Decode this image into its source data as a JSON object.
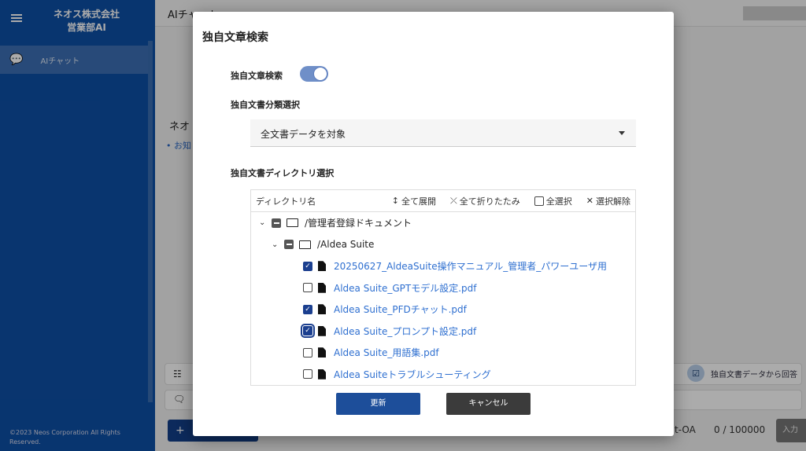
{
  "sidebar": {
    "brand_line1": "ネオス株式会社",
    "brand_line2": "営業部AI",
    "nav": [
      {
        "label": "AIチャット",
        "icon": "chat-bubbles-icon"
      }
    ],
    "copyright": "©2023 Neos Corporation All Rights Reserved."
  },
  "main": {
    "title": "AIチャット",
    "greeting": "ネオ",
    "notice_link": "お知",
    "indicator_label": "独自文書データから回答",
    "model": "t-OA",
    "char_count": "0 / 100000",
    "send_label": "入力",
    "new_label": "+"
  },
  "modal": {
    "title": "独自文章検索",
    "toggle_label": "独自文章検索",
    "toggle_on": true,
    "category_label": "独自文書分類選択",
    "category_value": "全文書データを対象",
    "dir_label": "独自文書ディレクトリ選択",
    "tree_header": {
      "name": "ディレクトリ名",
      "expand": "全て展開",
      "collapse": "全て折りたたみ",
      "select_all": "全選択",
      "deselect": "選択解除"
    },
    "folders": [
      {
        "name": "/管理者登録ドキュメント"
      },
      {
        "name": "/Aldea Suite"
      }
    ],
    "files": [
      {
        "name": "20250627_AldeaSuite操作マニュアル_管理者_パワーユーザ用",
        "checked": true
      },
      {
        "name": "Aldea Suite_GPTモデル設定.pdf",
        "checked": false
      },
      {
        "name": "Aldea Suite_PFDチャット.pdf",
        "checked": true
      },
      {
        "name": "Aldea Suite_プロンプト設定.pdf",
        "checked": true
      },
      {
        "name": "Aldea Suite_用語集.pdf",
        "checked": false
      },
      {
        "name": "Aldea Suiteトラブルシューティング",
        "checked": false
      }
    ],
    "update_label": "更新",
    "cancel_label": "キャンセル"
  },
  "colors": {
    "sidebar": "#0d4fa6",
    "accent": "#1d4e9a",
    "link": "#2e6fd0"
  }
}
